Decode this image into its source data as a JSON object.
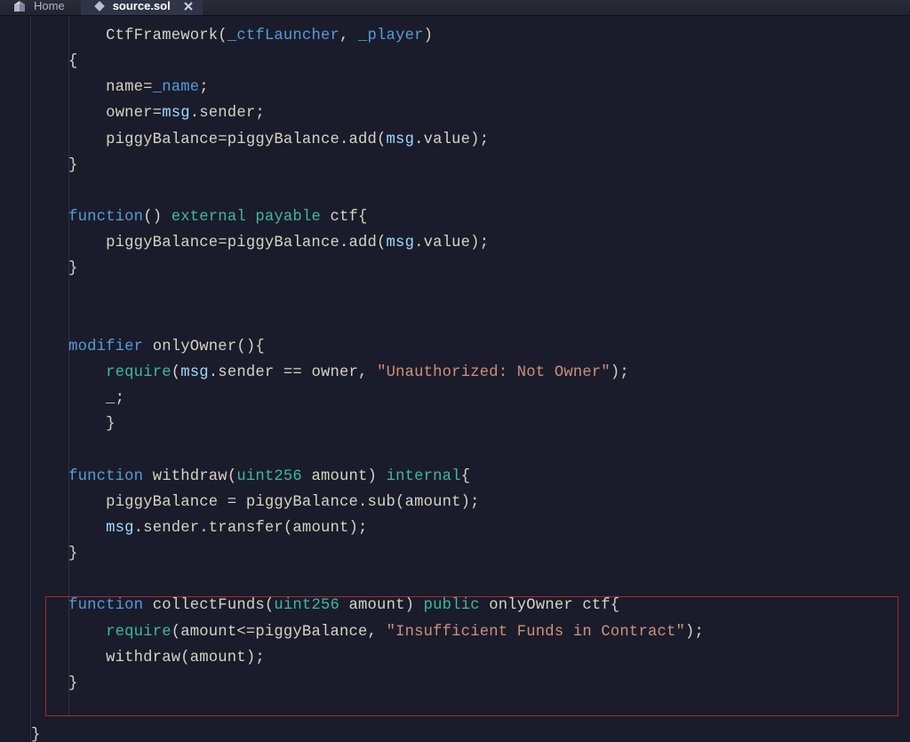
{
  "tabs": {
    "home_label": "Home",
    "active_label": "source.sol"
  },
  "code": {
    "lines": [
      "        CtfFramework(_ctfLauncher, _player)",
      "    {",
      "        name=_name;",
      "        owner=msg.sender;",
      "        piggyBalance=piggyBalance.add(msg.value);",
      "    }",
      "",
      "    function() external payable ctf{",
      "        piggyBalance=piggyBalance.add(msg.value);",
      "    }",
      "",
      "",
      "    modifier onlyOwner(){",
      "        require(msg.sender == owner, \"Unauthorized: Not Owner\");",
      "        _;",
      "        }",
      "",
      "    function withdraw(uint256 amount) internal{",
      "        piggyBalance = piggyBalance.sub(amount);",
      "        msg.sender.transfer(amount);",
      "    }",
      "",
      "    function collectFunds(uint256 amount) public onlyOwner ctf{",
      "        require(amount<=piggyBalance, \"Insufficient Funds in Contract\");",
      "        withdraw(amount);",
      "    }",
      "",
      "}"
    ]
  }
}
